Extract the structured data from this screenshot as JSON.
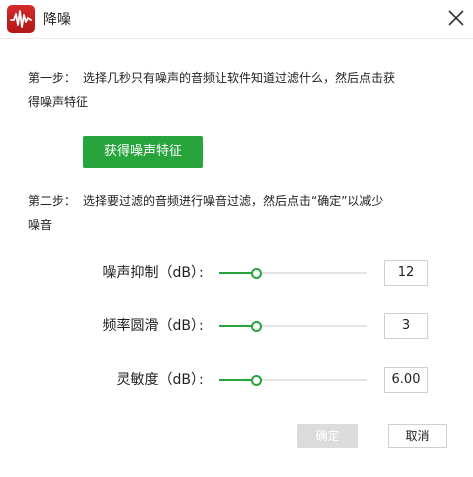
{
  "window": {
    "title": "降噪"
  },
  "step1": {
    "label": "第一步：",
    "text_line1": "选择几秒只有噪声的音频让软件知道过滤什么，然后点击获",
    "text_line2": "得噪声特征",
    "button_label": "获得噪声特征"
  },
  "step2": {
    "label": "第二步：",
    "text_line1": "选择要过滤的音频进行噪音过滤，然后点击“确定”以减少",
    "text_line2": "噪音"
  },
  "params": [
    {
      "label": "噪声抑制（dB）",
      "colon": ":",
      "value": "12",
      "fraction": 0.25
    },
    {
      "label": "频率圆滑（dB）",
      "colon": ":",
      "value": "3",
      "fraction": 0.25
    },
    {
      "label": "灵敏度（dB）",
      "colon": ":",
      "value": "6.00",
      "fraction": 0.25
    }
  ],
  "buttons": {
    "confirm": "确定",
    "cancel": "取消"
  },
  "colors": {
    "accent": "#27a53c",
    "app_icon": "#c82020",
    "disabled": "#dcdcdc"
  },
  "icons": {
    "app": "waveform-icon",
    "close": "close-icon"
  }
}
